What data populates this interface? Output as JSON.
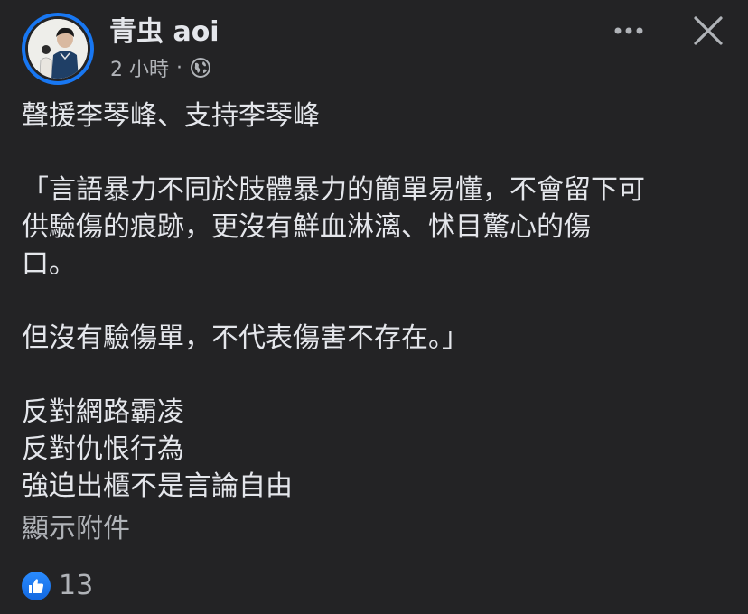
{
  "header": {
    "author_name": "青虫 aoi",
    "timestamp": "2 小時",
    "separator": "·",
    "privacy_icon": "globe-icon",
    "more_icon": "more-dots-icon",
    "close_icon": "close-icon"
  },
  "post": {
    "lines": [
      "聲援李琴峰、支持李琴峰",
      "",
      "「言語暴力不同於肢體暴力的簡單易懂，不會留下可",
      "供驗傷的痕跡，更沒有鮮血淋漓、怵目驚心的傷",
      "口。",
      "",
      "但沒有驗傷單，不代表傷害不存在。」",
      "",
      "反對網路霸凌",
      "反對仇恨行為",
      "強迫出櫃不是言論自由"
    ]
  },
  "attachment": {
    "label": "顯示附件"
  },
  "reactions": {
    "icon": "like-icon",
    "count": "13"
  },
  "colors": {
    "background": "#232325",
    "text_primary": "#e4e6eb",
    "text_secondary": "#b0b3b8",
    "accent": "#1877f2"
  }
}
